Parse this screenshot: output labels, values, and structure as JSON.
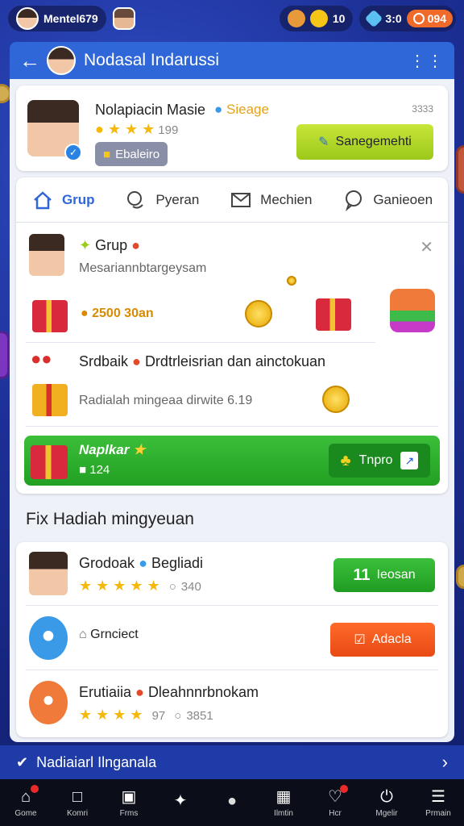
{
  "status_bar": {
    "username": "Mentel679",
    "currency_1_value": "10",
    "currency_2_value": "3:0",
    "currency_3_value": "094"
  },
  "header": {
    "title": "Nodasal Indarussi"
  },
  "profile": {
    "name": "Nolapiacin Masie",
    "tag": "Sieage",
    "score": "199",
    "badge_label": "Ebaleiro",
    "dots_label": "3333",
    "manage_label": "Sanegemehti"
  },
  "tabs": [
    {
      "label": "Grup"
    },
    {
      "label": "Pyeran"
    },
    {
      "label": "Mechien"
    },
    {
      "label": "Ganieoen"
    }
  ],
  "feed": {
    "title": "Grup",
    "subtitle": "Mesariannbtargeysam",
    "amount": "2500 30an",
    "row2_title": "Srdbaik",
    "row2_title_b": "Drdtrleisrian dan ainctokuan",
    "row2_sub": "Radialah mingeaa dirwite 6.19",
    "promo_title": "Naplkar",
    "promo_count": "124",
    "promo_button": "Tnpro"
  },
  "section_title": "Fix Hadiah mingyeuan",
  "weekly": [
    {
      "title": "Grodoak",
      "title_b": "Begliadi",
      "comments": "340",
      "button": "Ieosan",
      "button_count": "11"
    },
    {
      "title": "Grnciect",
      "button": "Adacla"
    },
    {
      "title": "Erutiaiia",
      "title_b": "Dleahnnrbnokam",
      "score": "97",
      "comments": "3851"
    }
  ],
  "notice": {
    "text": "Nadiaiarl Ilnganala"
  },
  "bottom_nav": [
    {
      "label": "Gome",
      "icon": "home-icon"
    },
    {
      "label": "Komri",
      "icon": "chat-icon"
    },
    {
      "label": "Frms",
      "icon": "square-icon"
    },
    {
      "label": "",
      "icon": "sparkle-icon"
    },
    {
      "label": "",
      "icon": "dot-icon"
    },
    {
      "label": "Ilmtin",
      "icon": "grid-icon"
    },
    {
      "label": "Hcr",
      "icon": "heart-icon"
    },
    {
      "label": "Mgelir",
      "icon": "power-icon"
    },
    {
      "label": "Prmain",
      "icon": "menu-icon"
    }
  ]
}
